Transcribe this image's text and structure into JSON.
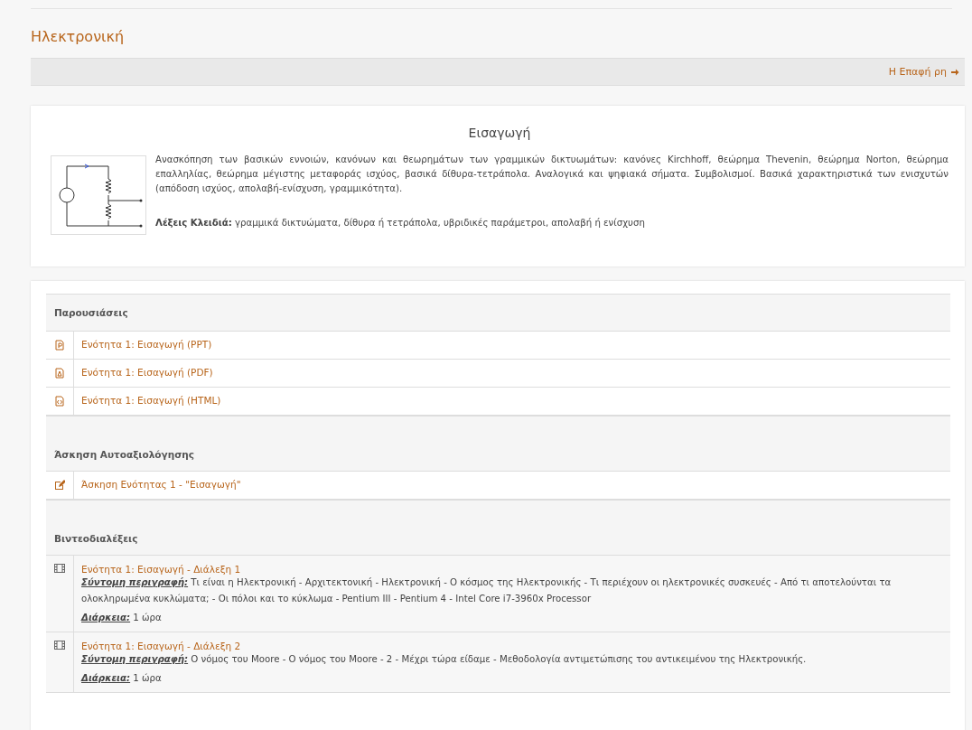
{
  "page_title": "Ηλεκτρονική",
  "toolbar": {
    "link": "Η Επαφή ρη"
  },
  "intro": {
    "title": "Εισαγωγή",
    "text": "Ανασκόπηση των βασικών εννοιών, κανόνων και θεωρημάτων των γραμμικών δικτυωμάτων: κανόνες Kirchhoff, θεώρημα Thevenin, θεώρημα Norton, θεώρημα επαλληλίας, θεώρημα μέγιστης μεταφοράς ισχύος, βασικά δίθυρα-τετράπολα. Αναλογικά και ψηφιακά σήματα. Συμβολισμοί. Βασικά χαρακτηριστικά των ενισχυτών (απόδοση ισχύος, απολαβή-ενίσχυση, γραμμικότητα).",
    "keywords_label": "Λέξεις Κλειδιά:",
    "keywords": "γραμμικά δικτυώματα, δίθυρα ή τετράπολα, υβριδικές παράμετροι, απολαβή ή ενίσχυση"
  },
  "sections": [
    {
      "title": "Παρουσιάσεις",
      "items": [
        {
          "kind": "ppt",
          "title": "Ενότητα 1: Εισαγωγή (PPT)"
        },
        {
          "kind": "pdf",
          "title": "Ενότητα 1: Εισαγωγή (PDF)"
        },
        {
          "kind": "html",
          "title": "Ενότητα 1: Εισαγωγή (HTML)"
        }
      ]
    },
    {
      "title": "Άσκηση Αυτοαξιολόγησης",
      "items": [
        {
          "kind": "exercise",
          "title": "Άσκηση Ενότητας 1 - \"Εισαγωγή\""
        }
      ]
    },
    {
      "title": "Βιντεοδιαλέξεις",
      "items": [
        {
          "kind": "video",
          "title": "Ενότητα 1: Εισαγωγή - Διάλεξη 1",
          "description_label": "Σύντομη περιγραφή:",
          "description": "Τι είναι η Ηλεκτρονική - Αρχιτεκτονική - Ηλεκτρονική - Ο κόσμος της Ηλεκτρονικής - Τι περιέχουν οι ηλεκτρονικές συσκευές - Από τι αποτελούνται τα ολοκληρωμένα κυκλώματα; - Οι πόλοι και το κύκλωμα - Pentium III - Pentium 4 - Intel Core i7-3960x Processor",
          "duration_label": "Διάρκεια:",
          "duration": "1 ώρα"
        },
        {
          "kind": "video",
          "title": "Ενότητα 1: Εισαγωγή - Διάλεξη 2",
          "description_label": "Σύντομη περιγραφή:",
          "description": "Ο νόμος του Moore - Ο νόμος του Moore - 2 - Μέχρι τώρα είδαμε - Μεθοδολογία αντιμετώπισης του αντικειμένου της Ηλεκτρονικής.",
          "duration_label": "Διάρκεια:",
          "duration": "1 ώρα"
        }
      ]
    }
  ]
}
